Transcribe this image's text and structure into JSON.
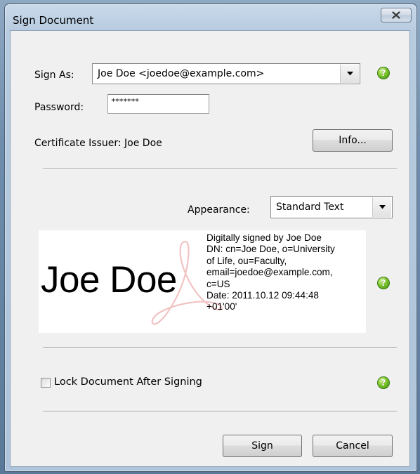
{
  "window": {
    "title": "Sign Document",
    "close_icon": "close-icon"
  },
  "sign_as": {
    "label": "Sign As:",
    "value": "Joe Doe <joedoe@example.com>"
  },
  "password": {
    "label": "Password:",
    "value": "*******"
  },
  "issuer": {
    "label": "Certificate Issuer: Joe Doe",
    "info_button": "Info..."
  },
  "appearance": {
    "label": "Appearance:",
    "value": "Standard Text"
  },
  "preview": {
    "name": "Joe Doe",
    "lines": [
      "Digitally signed by Joe Doe",
      "DN: cn=Joe Doe, o=University",
      "of Life, ou=Faculty,",
      "email=joedoe@example.com,",
      "c=US",
      "Date: 2011.10.12 09:44:48",
      "+01'00'"
    ]
  },
  "lock": {
    "label": "Lock Document After Signing",
    "checked": false
  },
  "buttons": {
    "sign": "Sign",
    "cancel": "Cancel"
  },
  "help_icon": {
    "glyph": "?"
  },
  "colors": {
    "help_green": "#7ec62c",
    "frame_blue": "#b7cbe0",
    "dialog_bg": "#f0f0f0"
  }
}
